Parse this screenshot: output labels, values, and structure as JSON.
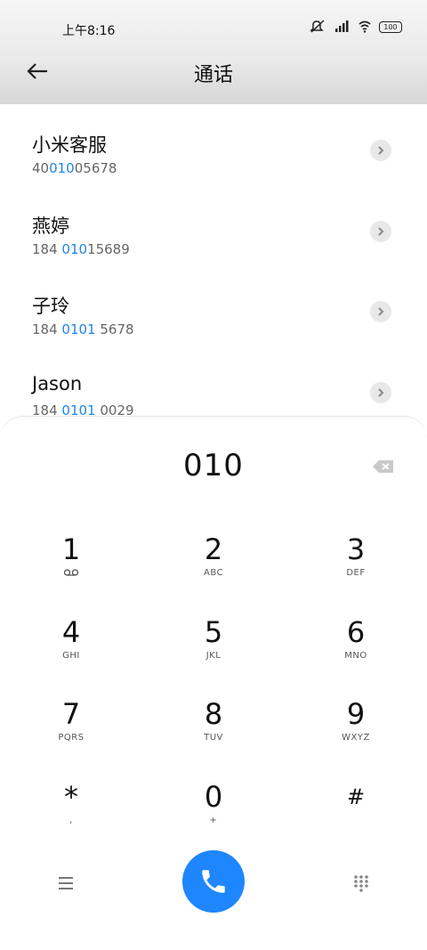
{
  "status_bar": {
    "time": "上午8:16",
    "battery": "100"
  },
  "header": {
    "title": "通话"
  },
  "contacts": [
    {
      "name": "小米客服",
      "number_pre": "40",
      "number_hl": "010",
      "number_post": "05678"
    },
    {
      "name": "燕婷",
      "number_pre": "184 ",
      "number_hl": "010",
      "number_post": "15689"
    },
    {
      "name": "子玲",
      "number_pre": "184 ",
      "number_hl": "0101",
      "number_post": " 5678"
    },
    {
      "name": "Jason",
      "number_pre": "184 ",
      "number_hl": "0101",
      "number_post": " 0029"
    }
  ],
  "dialer": {
    "input_value": "010",
    "keys": [
      {
        "digit": "1",
        "letters": ""
      },
      {
        "digit": "2",
        "letters": "ABC"
      },
      {
        "digit": "3",
        "letters": "DEF"
      },
      {
        "digit": "4",
        "letters": "GHI"
      },
      {
        "digit": "5",
        "letters": "JKL"
      },
      {
        "digit": "6",
        "letters": "MNO"
      },
      {
        "digit": "7",
        "letters": "PQRS"
      },
      {
        "digit": "8",
        "letters": "TUV"
      },
      {
        "digit": "9",
        "letters": "WXYZ"
      },
      {
        "digit": "*",
        "letters": ","
      },
      {
        "digit": "0",
        "letters": "+"
      },
      {
        "digit": "#",
        "letters": ""
      }
    ]
  },
  "colors": {
    "accent": "#1e86ff",
    "highlight": "#1e86e8"
  },
  "icons": {
    "back": "arrow-left-icon",
    "go": "chevron-right-icon",
    "backspace": "backspace-icon",
    "voicemail": "voicemail-icon",
    "call": "phone-icon",
    "menu": "menu-icon",
    "keypad": "dialpad-icon"
  }
}
